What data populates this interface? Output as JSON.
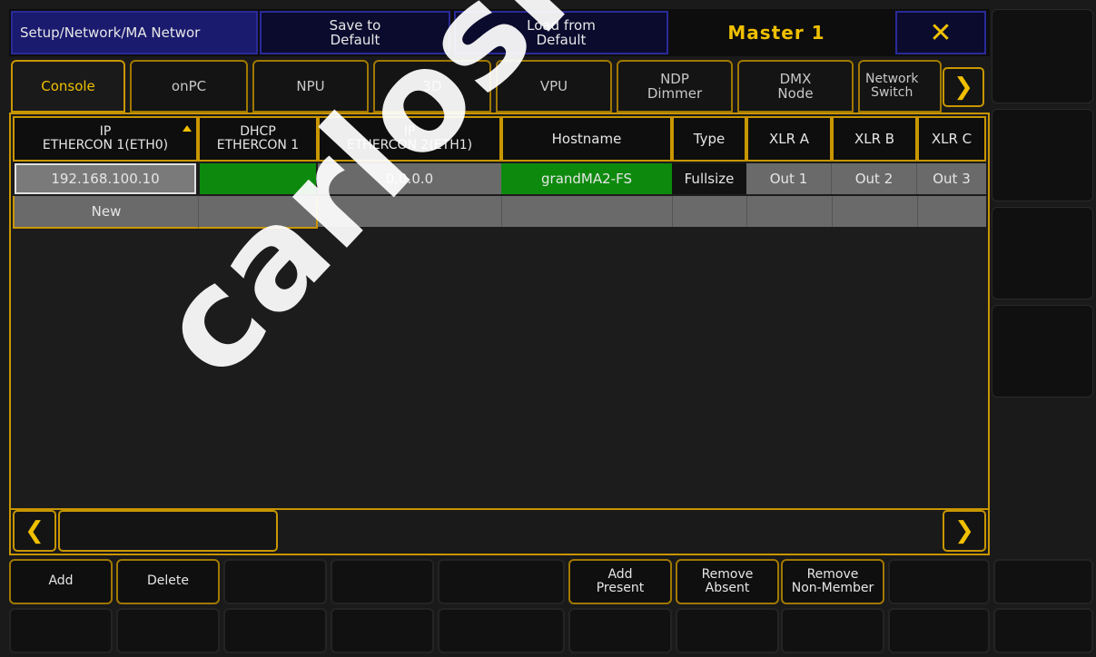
{
  "title_bar": {
    "title": "Setup/Network/MA Networ",
    "save_default": "Save to\nDefault",
    "load_default": "Load from\nDefault",
    "master": "Master 1",
    "close_icon": "close-icon"
  },
  "tabs": [
    "Console",
    "onPC",
    "NPU",
    "3D",
    "VPU",
    "NDP\nDimmer",
    "DMX\nNode",
    "Network\nSwitch"
  ],
  "table": {
    "headers": [
      "IP\nETHERCON 1(ETH0)",
      "DHCP\nETHERCON 1",
      "IP\nETHERCON 2(ETH1)",
      "Hostname",
      "Type",
      "XLR A",
      "XLR B",
      "XLR C"
    ],
    "rows": [
      [
        "192.168.100.10",
        "",
        "0.0.0.0",
        "grandMA2-FS",
        "Fullsize",
        "Out 1",
        "Out 2",
        "Out 3"
      ]
    ],
    "new_label": "New"
  },
  "bottom": {
    "add": "Add",
    "delete": "Delete",
    "add_present": "Add\nPresent",
    "remove_absent": "Remove\nAbsent",
    "remove_non_member": "Remove\nNon-Member"
  },
  "watermark": "carlosmendoza",
  "colors": {
    "accent": "#f0c000",
    "green": "#0d8a0d",
    "blue": "#1a1a6e"
  }
}
